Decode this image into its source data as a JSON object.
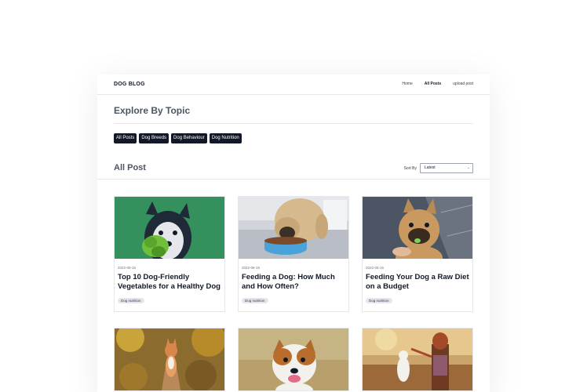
{
  "header": {
    "brand": "DOG BLOG",
    "nav": [
      "Home",
      "All Posts",
      "upload post"
    ]
  },
  "explore": {
    "title": "Explore By Topic",
    "topics": [
      "All Posts",
      "Dog Breeds",
      "Dog Behaviour",
      "Dog Nutrition"
    ]
  },
  "posts_section": {
    "title": "All Post",
    "sort_label": "Sort By",
    "sort_value": "Latest"
  },
  "posts": [
    {
      "date": "2022-06-15",
      "title": "Top 10 Dog-Friendly Vegetables for a Healthy Dog",
      "tag": "Dog nutrition"
    },
    {
      "date": "2022-06-15",
      "title": "Feeding a Dog: How Much and How Often?",
      "tag": "Dog nutrition"
    },
    {
      "date": "2022-06-15",
      "title": "Feeding Your Dog a Raw Diet on a Budget",
      "tag": "Dog nutrition"
    }
  ],
  "colors": {
    "chip_bg": "#111827",
    "heading": "#4b5563"
  }
}
